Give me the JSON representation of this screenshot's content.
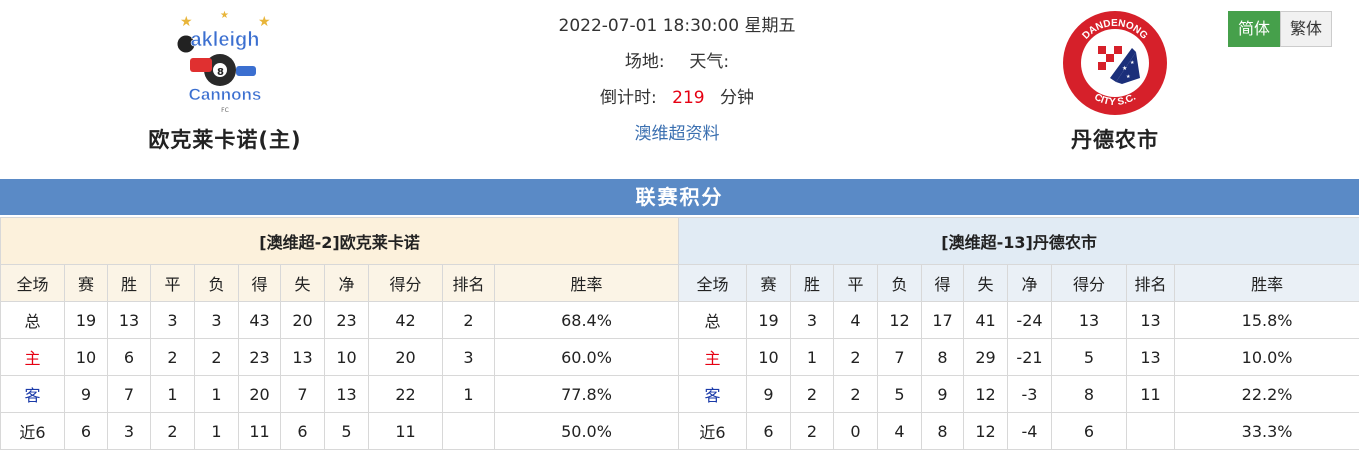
{
  "match": {
    "datetime": "2022-07-01 18:30:00",
    "weekday": "星期五",
    "venue_label": "场地:",
    "weather_label": "天气:",
    "countdown_label": "倒计时:",
    "countdown_value": "219",
    "countdown_unit": "分钟",
    "league_link": "澳维超资料"
  },
  "home_team": {
    "name": "欧克莱卡诺(主)",
    "logo_text": [
      "Oakleigh",
      "Cannons"
    ]
  },
  "away_team": {
    "name": "丹德农市",
    "logo_text": [
      "DANDENONG",
      "CITY S.C."
    ]
  },
  "lang": {
    "simplified": "简体",
    "traditional": "繁体"
  },
  "section_title": "联赛积分",
  "standings_home": {
    "title": "[澳维超-2]欧克莱卡诺",
    "columns": [
      "全场",
      "赛",
      "胜",
      "平",
      "负",
      "得",
      "失",
      "净",
      "得分",
      "排名",
      "胜率"
    ],
    "rows": [
      [
        "总",
        "19",
        "13",
        "3",
        "3",
        "43",
        "20",
        "23",
        "42",
        "2",
        "68.4%"
      ],
      [
        "主",
        "10",
        "6",
        "2",
        "2",
        "23",
        "13",
        "10",
        "20",
        "3",
        "60.0%"
      ],
      [
        "客",
        "9",
        "7",
        "1",
        "1",
        "20",
        "7",
        "13",
        "22",
        "1",
        "77.8%"
      ],
      [
        "近6",
        "6",
        "3",
        "2",
        "1",
        "11",
        "6",
        "5",
        "11",
        "",
        "50.0%"
      ]
    ]
  },
  "standings_away": {
    "title": "[澳维超-13]丹德农市",
    "columns": [
      "全场",
      "赛",
      "胜",
      "平",
      "负",
      "得",
      "失",
      "净",
      "得分",
      "排名",
      "胜率"
    ],
    "rows": [
      [
        "总",
        "19",
        "3",
        "4",
        "12",
        "17",
        "41",
        "-24",
        "13",
        "13",
        "15.8%"
      ],
      [
        "主",
        "10",
        "1",
        "2",
        "7",
        "8",
        "29",
        "-21",
        "5",
        "13",
        "10.0%"
      ],
      [
        "客",
        "9",
        "2",
        "2",
        "5",
        "9",
        "12",
        "-3",
        "8",
        "11",
        "22.2%"
      ],
      [
        "近6",
        "6",
        "2",
        "0",
        "4",
        "8",
        "12",
        "-4",
        "6",
        "",
        "33.3%"
      ]
    ]
  },
  "colors": {
    "header_blue": "#5a8ac6",
    "active_green": "#46a04b",
    "home_label": "#e60012",
    "away_label": "#1a3aa8"
  }
}
